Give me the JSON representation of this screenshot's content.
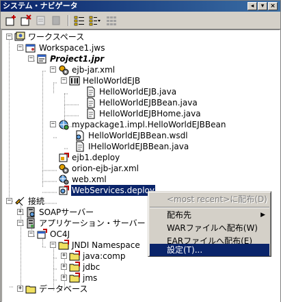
{
  "window": {
    "title": "システム・ナビゲータ",
    "title_buttons": [
      "◂",
      "▾",
      "×"
    ]
  },
  "toolbar": {
    "buttons": [
      {
        "name": "new-icon",
        "enabled": true
      },
      {
        "name": "remove-icon",
        "enabled": true
      },
      {
        "name": "disabled-icon-1",
        "enabled": false
      },
      {
        "name": "disabled-icon-2",
        "enabled": false
      },
      {
        "name": "list-view-icon",
        "enabled": true
      },
      {
        "name": "sort-list-icon",
        "enabled": true
      },
      {
        "name": "grid-view-icon",
        "enabled": false
      }
    ]
  },
  "tree": {
    "items": [
      {
        "label": "ワークスペース",
        "icon": "workspaces-icon"
      },
      {
        "label": "Workspace1.jws",
        "icon": "workspace-icon"
      },
      {
        "label": "Project1.jpr",
        "icon": "project-icon"
      },
      {
        "label": "ejb-jar.xml",
        "icon": "ejb-xml-icon"
      },
      {
        "label": "HelloWorldEJB",
        "icon": "ejb-icon"
      },
      {
        "label": "HelloWorldEJB.java",
        "icon": "java-file-icon"
      },
      {
        "label": "HelloWorldEJBBean.java",
        "icon": "java-file-icon"
      },
      {
        "label": "HelloWorldEJBHome.java",
        "icon": "java-file-icon"
      },
      {
        "label": "mypackage1.impl.HelloWorldEJBBean",
        "icon": "web-service-icon"
      },
      {
        "label": "HelloWorldEJBBean.wsdl",
        "icon": "wsdl-file-icon"
      },
      {
        "label": "IHelloWorldEJBBean.java",
        "icon": "java-file-icon"
      },
      {
        "label": "ejb1.deploy",
        "icon": "deploy-icon"
      },
      {
        "label": "orion-ejb-jar.xml",
        "icon": "ejb-xml-icon"
      },
      {
        "label": "web.xml",
        "icon": "web-xml-icon"
      },
      {
        "label": "WebServices.deploy",
        "icon": "deploy-ws-icon"
      },
      {
        "label": "接続",
        "icon": "connections-icon"
      },
      {
        "label": "SOAPサーバー",
        "icon": "soap-server-icon"
      },
      {
        "label": "アプリケーション・サーバー",
        "icon": "app-server-icon"
      },
      {
        "label": "OC4J",
        "icon": "oc4j-icon"
      },
      {
        "label": "JNDI Namespace",
        "icon": "folder-icon"
      },
      {
        "label": "java:comp",
        "icon": "folder-icon"
      },
      {
        "label": "jdbc",
        "icon": "folder-icon"
      },
      {
        "label": "jms",
        "icon": "folder-icon"
      },
      {
        "label": "データベース",
        "icon": "folder-icon"
      }
    ]
  },
  "context_menu": {
    "items": [
      {
        "label": "<most recent>に配布(D)",
        "enabled": false
      },
      {
        "label": "配布先",
        "submenu_arrow": "▶"
      },
      {
        "label": "WARファイルへ配布(W)"
      },
      {
        "label": "EARファイルへ配布(E)"
      },
      {
        "label": "設定(T)..."
      }
    ]
  },
  "colors": {
    "selection": "#0a246a",
    "chrome": "#d4d0c8",
    "tree_background": "#ffffff"
  }
}
